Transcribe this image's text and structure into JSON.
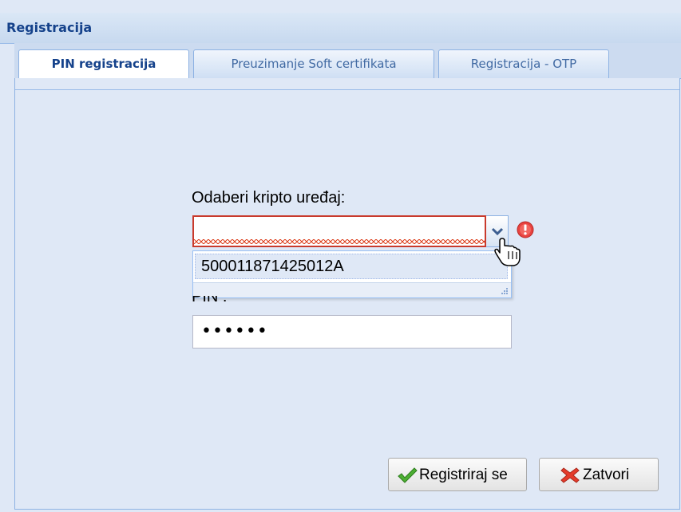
{
  "panel": {
    "title": "Registracija"
  },
  "tabs": [
    {
      "label": "PIN registracija",
      "active": true
    },
    {
      "label": "Preuzimanje Soft certifikata",
      "active": false
    },
    {
      "label": "Registracija - OTP",
      "active": false
    }
  ],
  "form": {
    "device_label": "Odaberi kripto uređaj:",
    "device_value": "",
    "device_options": [
      "500011871425012A"
    ],
    "pin_label": "PIN :",
    "pin_value": "••••••"
  },
  "buttons": {
    "register_label": "Registriraj se",
    "close_label": "Zatvori"
  },
  "colors": {
    "header_text": "#15428b",
    "invalid_border": "#c93a2c",
    "error_icon": "#e8423f",
    "register_icon": "#3c9a2a",
    "close_icon": "#e03b2a"
  },
  "icons": {
    "trigger": "chevron-down-icon",
    "error": "error-icon",
    "cursor": "hand-cursor-icon",
    "register": "checkmark-icon",
    "close": "red-x-icon"
  }
}
